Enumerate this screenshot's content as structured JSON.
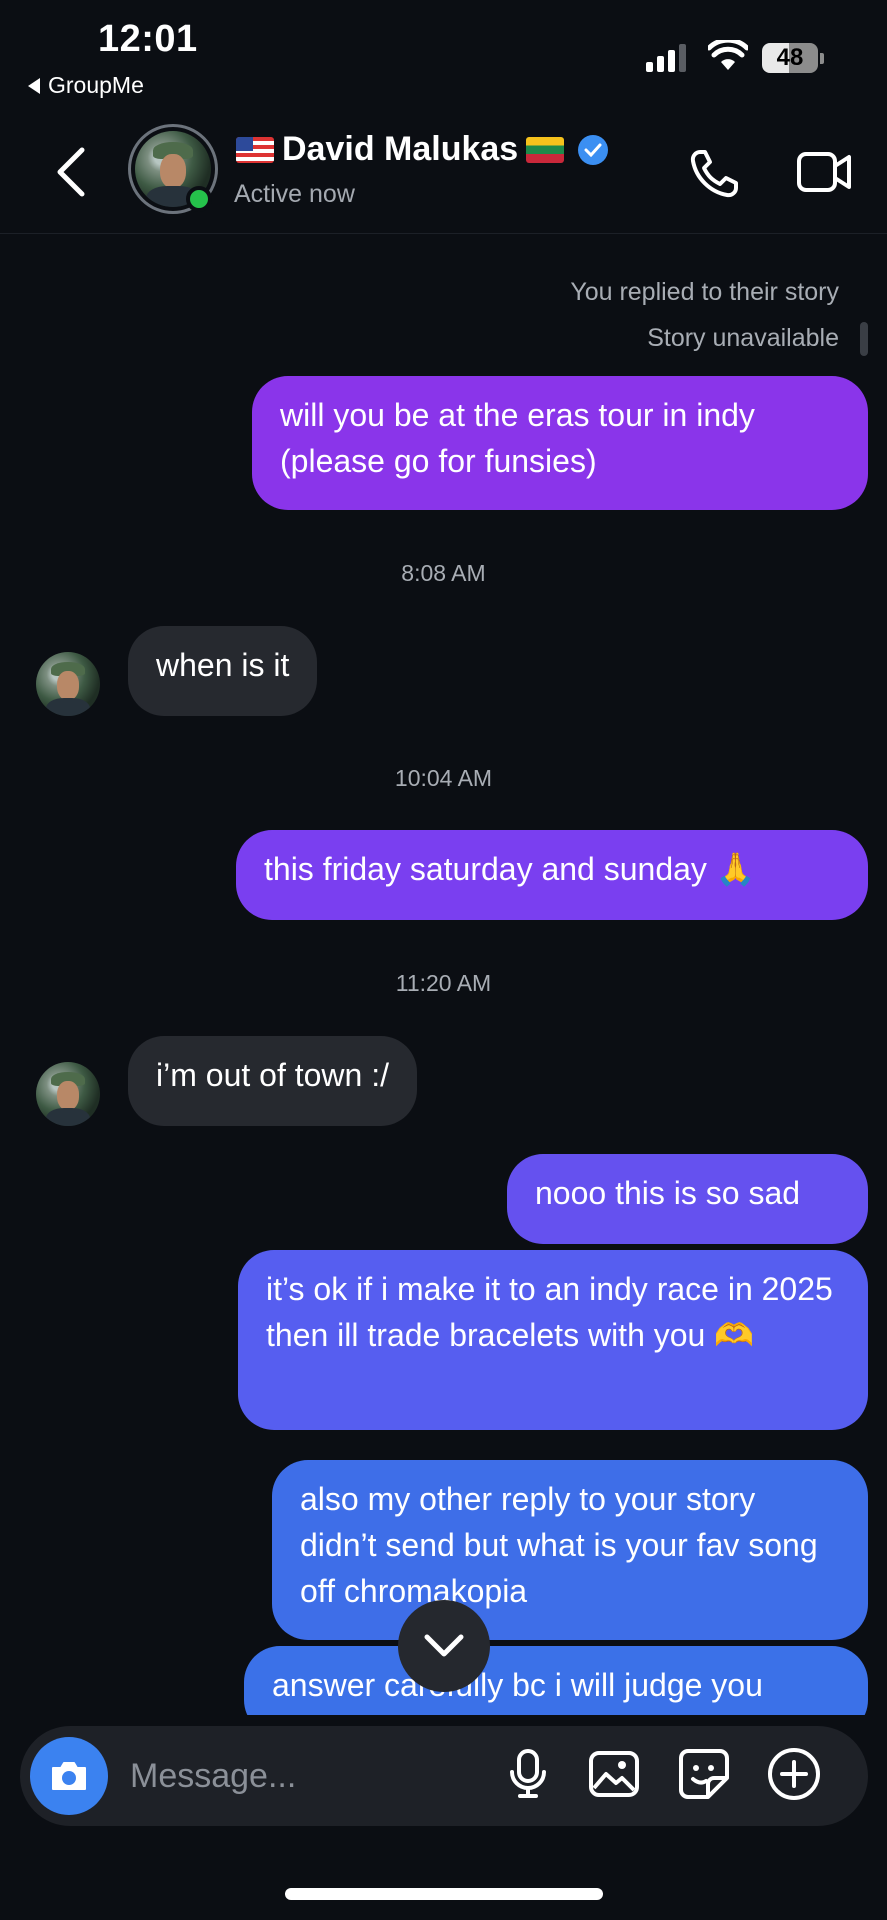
{
  "status_bar": {
    "time": "12:01",
    "back_app_label": "GroupMe",
    "battery": "48",
    "signal_icon": "cellular-signal-icon",
    "wifi_icon": "wifi-icon"
  },
  "header": {
    "name": "David Malukas",
    "status": "Active now",
    "flags": [
      "us-flag-emoji",
      "lithuania-flag-emoji"
    ],
    "verified": true,
    "icons": [
      "back-chevron-icon",
      "phone-icon",
      "video-camera-icon"
    ]
  },
  "chat": {
    "story_reply_label": "You replied to their story",
    "story_unavailable_label": "Story unavailable",
    "messages": [
      {
        "side": "sent",
        "text": "will you be at the eras tour in indy (please go for funsies)"
      },
      {
        "timestamp": "8:08 AM"
      },
      {
        "side": "received",
        "text": "when is it"
      },
      {
        "timestamp": "10:04 AM"
      },
      {
        "side": "sent",
        "text": "this friday saturday and sunday 🙏"
      },
      {
        "timestamp": "11:20 AM"
      },
      {
        "side": "received",
        "text": "i’m out of town :/"
      },
      {
        "side": "sent",
        "text": "nooo this is so sad"
      },
      {
        "side": "sent",
        "text": "it’s ok if i make it to an indy race in 2025 then ill trade bracelets with you 🫶"
      },
      {
        "side": "sent",
        "text": "also my other reply to your story didn’t send but what is your fav song off chromakopia"
      },
      {
        "side": "sent",
        "text": "answer carefully bc i will judge you"
      }
    ],
    "timestamps": [
      "8:08 AM",
      "10:04 AM",
      "11:20 AM"
    ],
    "colors": {
      "sent_top": "#8a35ea",
      "sent_bottom": "#3b71e8",
      "received": "#26292f",
      "background": "#0b0e13"
    }
  },
  "composer": {
    "placeholder": "Message...",
    "icons": [
      "camera-icon",
      "microphone-icon",
      "gallery-icon",
      "sticker-icon",
      "add-icon"
    ]
  }
}
